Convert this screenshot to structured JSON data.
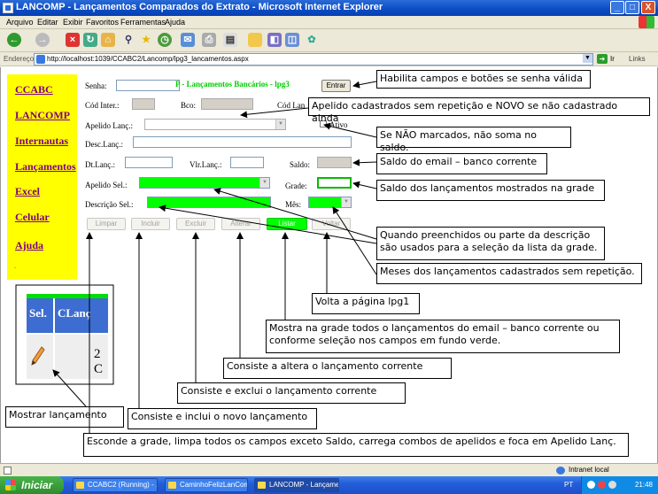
{
  "window": {
    "title": "LANCOMP - Lançamentos Comparados do Extrato - Microsoft Internet Explorer",
    "min_label": "_",
    "max_label": "□",
    "close_label": "X"
  },
  "menu": [
    "Arquivo",
    "Editar",
    "Exibir",
    "Favoritos",
    "Ferramentas",
    "Ajuda"
  ],
  "address": {
    "label": "Endereço",
    "url": "http://localhost:1039/CCABC2/Lancomp/lpg3_lancamentos.aspx",
    "go_label": "Ir",
    "links_label": "Links"
  },
  "nav": {
    "items": [
      "CCABC",
      "LANCOMP",
      "Internautas",
      "Lançamentos",
      "Excel",
      "Celular",
      "Ajuda"
    ],
    "bullet": "."
  },
  "form": {
    "title": "P - Lançamentos Bancários - lpg3",
    "senha_label": "Senha:",
    "entrar_label": "Entrar",
    "cod_inter_label": "Cód Inter.:",
    "bco_label": "Bco:",
    "cod_lanc_label": "Cód Lan",
    "apelido_lanc_label": "Apelido Lanç.:",
    "ativo_label": "Ativo",
    "desc_lanc_label": "Desc.Lanç.:",
    "dt_lanc_label": "Dt.Lanç.:",
    "vlr_lanc_label": "Vlr.Lanç.:",
    "saldo_label": "Saldo:",
    "apelido_sel_label": "Apelido Sel.:",
    "grade_label": "Grade:",
    "descricao_sel_label": "Descrição Sel.:",
    "mes_label": "Mês:",
    "buttons": {
      "limpar": "Limpar",
      "incluir": "Incluir",
      "excluir": "Excluir",
      "alterar": "Alterar",
      "listar": "Listar",
      "voltar": "Voltar"
    }
  },
  "grid_snippet": {
    "col1": "Sel.",
    "col2": "CLanç",
    "value": "2 C",
    "pencil_icon": "pencil-edit-icon"
  },
  "callouts": {
    "entrar": "Habilita campos e botões  se senha válida",
    "apelido": "Apelido cadastrados sem repetição e NOVO se não cadastrado ainda",
    "ativo": "Se NÃO marcados, não soma no saldo.",
    "saldo": "Saldo do email – banco corrente",
    "grade": "Saldo dos lançamentos mostrados na grade",
    "selecao": "Quando preenchidos ou parte da descrição são usados para a seleção da lista da grade.",
    "meses": "Meses dos lançamentos cadastrados sem repetição.",
    "voltar": "Volta a página lpg1",
    "listar": "Mostra na grade todos  o lançamentos do email – banco corrente ou conforme seleção  nos campos em fundo verde.",
    "alterar": "Consiste a altera o lançamento corrente",
    "excluir": "Consiste e exclui o lançamento corrente",
    "incluir": "Consiste e inclui o novo  lançamento",
    "mostrar": "Mostrar lançamento",
    "limpar": "Esconde a grade, limpa todos os campos exceto Saldo, carrega combos de apelidos  e foca em Apelido Lanç."
  },
  "statusbar": {
    "zone": "Intranet local"
  },
  "taskbar": {
    "start": "Iniciar",
    "tasks": [
      "CCABC2 (Running) - ...",
      "CaminhoFelizLanCom...",
      "LANCOMP - Lançame..."
    ],
    "lang": "PT",
    "time": "21:48"
  },
  "colors": {
    "accent_green": "#00ff00",
    "nav_yellow": "#ffff00",
    "link_purple": "#800080",
    "title_green": "#00cc00"
  }
}
